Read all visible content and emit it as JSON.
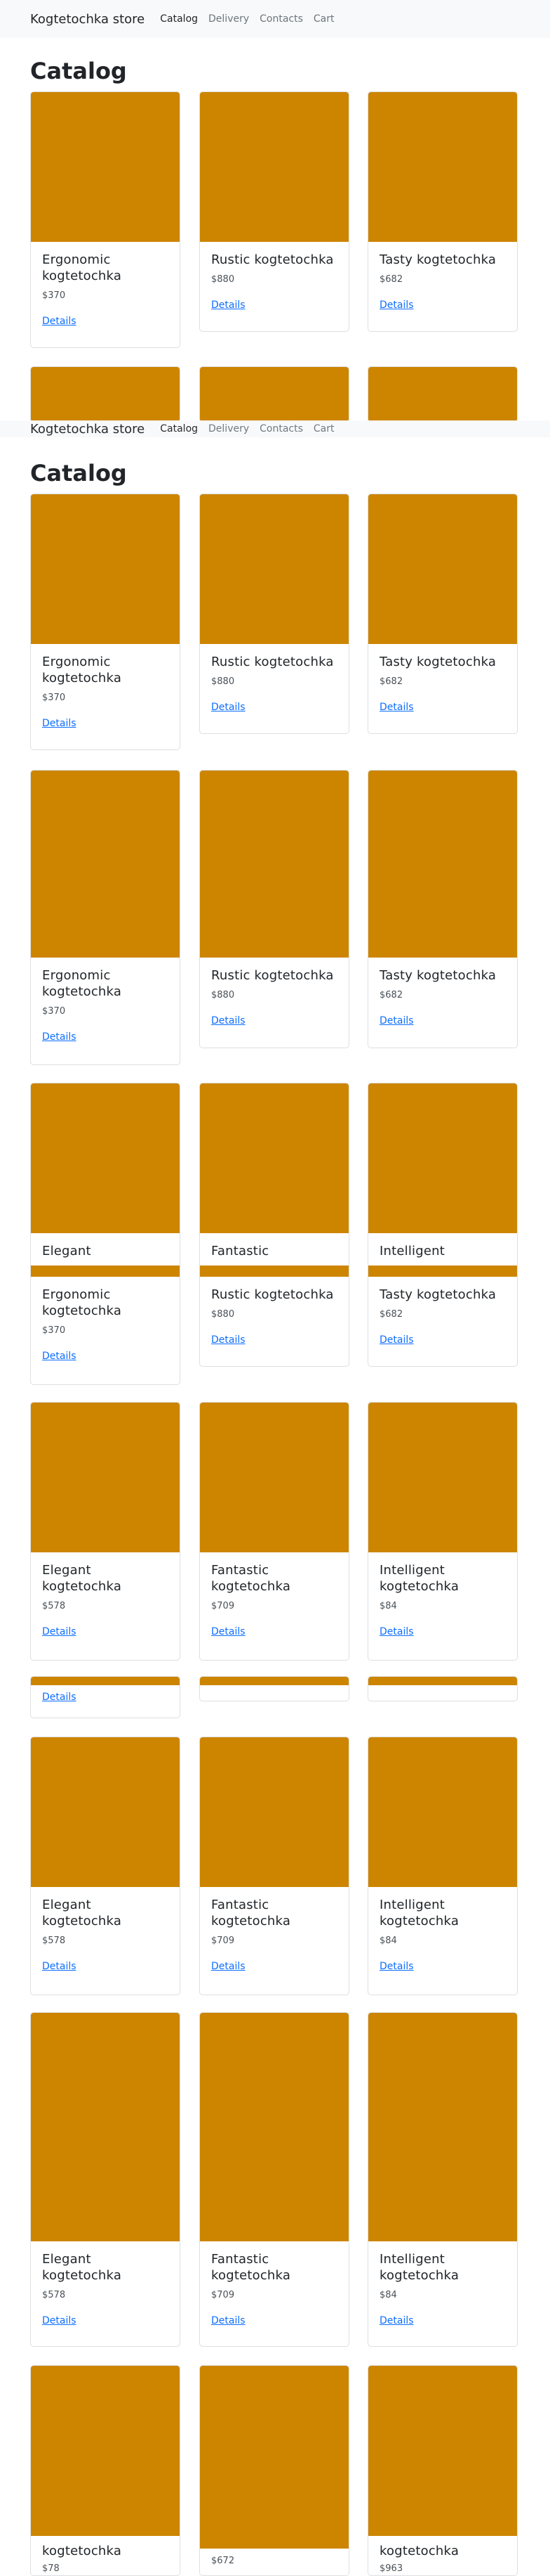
{
  "store": {
    "brand": "Kogtetochka store",
    "nav": [
      "Catalog",
      "Delivery",
      "Contacts",
      "Cart"
    ]
  },
  "catalog": {
    "title": "Catalog",
    "details_label": "Details"
  },
  "products": [
    {
      "name": "Ergonomic kogtetochka",
      "price": "$370"
    },
    {
      "name": "Rustic kogtetochka",
      "price": "$880"
    },
    {
      "name": "Tasty kogtetochka",
      "price": "$682"
    },
    {
      "name": "Elegant kogtetochka",
      "price": "$578"
    },
    {
      "name": "Fantastic kogtetochka",
      "price": "$709"
    },
    {
      "name": "Intelligent kogtetochka",
      "price": "$84"
    }
  ],
  "partial": {
    "elegant": "Elegant",
    "fantastic": "Fantastic",
    "intelligent": "Intelligent",
    "name_tail": "kogtetochka",
    "price_a": "$78",
    "price_b": "$672",
    "price_c": "$963"
  },
  "colors": {
    "card_image": "#cd8500",
    "navbar": "#f8f9fa",
    "link": "#0d6efd"
  }
}
